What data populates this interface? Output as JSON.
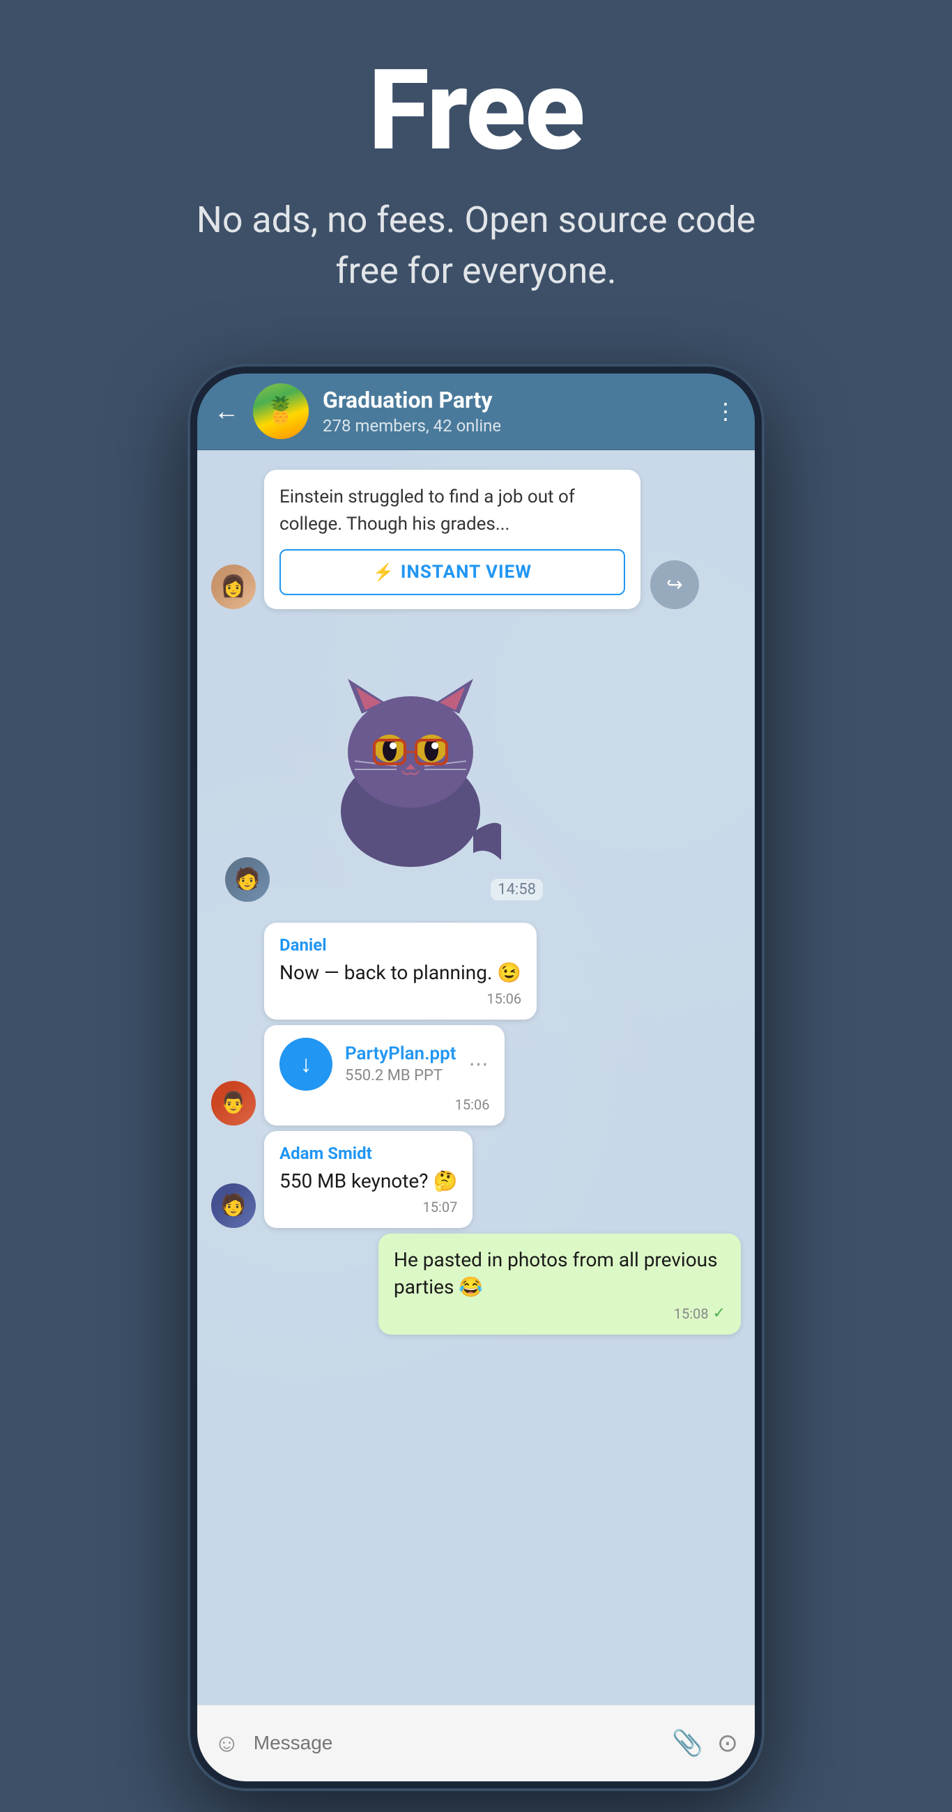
{
  "hero": {
    "title": "Free",
    "subtitle": "No ads, no fees. Open source code free for everyone."
  },
  "phone": {
    "header": {
      "group_name": "Graduation Party",
      "group_info": "278 members, 42 online",
      "back_label": "←",
      "more_label": "⋮"
    },
    "messages": [
      {
        "id": "msg1",
        "type": "instant_view",
        "avatar": "girl",
        "text": "Einstein struggled to find a job out of college. Though his grades...",
        "button_label": "INSTANT VIEW",
        "button_icon": "⚡"
      },
      {
        "id": "msg2",
        "type": "sticker",
        "avatar": "guy1",
        "timestamp": "14:58"
      },
      {
        "id": "msg3",
        "type": "text",
        "avatar": "none",
        "sender": "Daniel",
        "sender_color": "#2196f3",
        "text": "Now — back to planning. 😉",
        "timestamp": "15:06"
      },
      {
        "id": "msg4",
        "type": "file",
        "avatar": "guy2",
        "file_name": "PartyPlan.ppt",
        "file_size": "550.2 MB PPT",
        "timestamp": "15:06"
      },
      {
        "id": "msg5",
        "type": "text",
        "avatar": "guy3",
        "sender": "Adam Smidt",
        "sender_color": "#2196f3",
        "text": "550 MB keynote? 🤔",
        "timestamp": "15:07"
      },
      {
        "id": "msg6",
        "type": "outgoing",
        "text": "He pasted in photos from all previous parties 😂",
        "timestamp": "15:08",
        "check": "✓"
      }
    ],
    "input_bar": {
      "placeholder": "Message",
      "emoji_icon": "☺",
      "attachment_icon": "📎",
      "camera_icon": "⊙"
    }
  }
}
